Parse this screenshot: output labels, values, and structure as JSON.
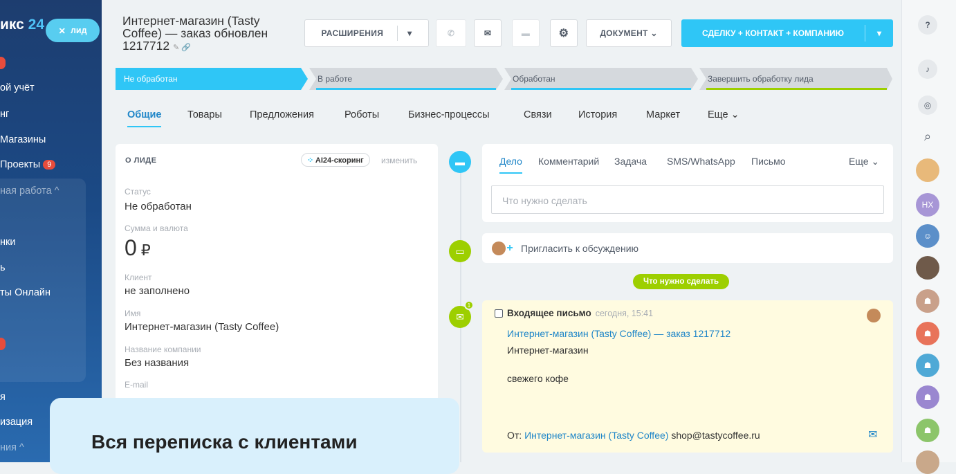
{
  "sidebar": {
    "logo_text": "икс",
    "logo_num": "24",
    "lead_pill": "лид",
    "items": [
      {
        "label": "ой учёт"
      },
      {
        "label": "нг"
      },
      {
        "label": "Магазины"
      },
      {
        "label": "Проекты",
        "badge": "9"
      },
      {
        "label": "ная работа ^"
      },
      {
        "label": "нки"
      },
      {
        "label": "ь"
      },
      {
        "label": "ты Онлайн"
      },
      {
        "label": "я"
      },
      {
        "label": "изация"
      },
      {
        "label": "ния ^"
      }
    ]
  },
  "header": {
    "title": "Интернет-магазин (Tasty Coffee) — заказ обновлен 1217712",
    "ext_btn": "РАСШИРЕНИЯ",
    "doc_btn": "ДОКУМЕНТ",
    "convert_btn": "СДЕЛКУ + КОНТАКТ + КОМПАНИЮ"
  },
  "stages": [
    "Не обработан",
    "В работе",
    "Обработан",
    "Завершить обработку лида"
  ],
  "tabs": [
    "Общие",
    "Товары",
    "Предложения",
    "Роботы",
    "Бизнес-процессы",
    "Связи",
    "История",
    "Маркет",
    "Еще"
  ],
  "lead": {
    "heading": "О ЛИДЕ",
    "ai_pill": "AI24-скоринг",
    "change": "изменить",
    "status_label": "Статус",
    "status_value": "Не обработан",
    "sum_label": "Сумма и валюта",
    "sum_value": "0",
    "currency": "₽",
    "client_label": "Клиент",
    "client_value": "не заполнено",
    "name_label": "Имя",
    "name_value": "Интернет-магазин (Tasty Coffee)",
    "company_label": "Название компании",
    "company_value": "Без названия",
    "email_label": "E-mail"
  },
  "activity": {
    "tabs": [
      "Дело",
      "Комментарий",
      "Задача",
      "SMS/WhatsApp",
      "Письмо",
      "Еще"
    ],
    "placeholder": "Что нужно сделать",
    "invite": "Пригласить к обсуждению",
    "todo_pill": "Что нужно сделать",
    "mail_count": "1"
  },
  "mail": {
    "title": "Входящее письмо",
    "time": "сегодня, 15:41",
    "subject": "Интернет-магазин (Tasty Coffee) — заказ 1217712",
    "line1": "Интернет-магазин",
    "line2": "свежего кофе",
    "from_label": "От:",
    "from_name": "Интернет-магазин (Tasty Coffee)",
    "from_email": "shop@tastycoffee.ru"
  },
  "right": {
    "hx": "НХ"
  },
  "overlay": {
    "text": "Вся переписка с клиентами"
  },
  "colors": {
    "accent": "#2fc6f6",
    "green": "#9dcf00",
    "link": "#1f86c8"
  }
}
